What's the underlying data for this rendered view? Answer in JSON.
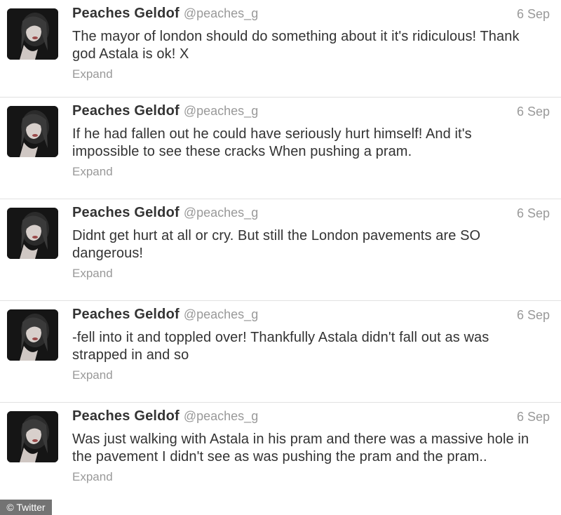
{
  "tweets": [
    {
      "name": "Peaches Geldof",
      "handle": "@peaches_g",
      "date": "6 Sep",
      "text": "The mayor of london should do something about it it's ridiculous! Thank god Astala is ok! X",
      "expand": "Expand"
    },
    {
      "name": "Peaches Geldof",
      "handle": "@peaches_g",
      "date": "6 Sep",
      "text": "If he had fallen out he could have seriously hurt himself! And it's impossible to see these cracks When pushing a pram.",
      "expand": "Expand"
    },
    {
      "name": "Peaches Geldof",
      "handle": "@peaches_g",
      "date": "6 Sep",
      "text": "Didnt get hurt at all or cry. But still the London pavements are SO dangerous!",
      "expand": "Expand"
    },
    {
      "name": "Peaches Geldof",
      "handle": "@peaches_g",
      "date": "6 Sep",
      "text": "-fell into it and toppled over! Thankfully Astala didn't fall out as was strapped in and so",
      "expand": "Expand"
    },
    {
      "name": "Peaches Geldof",
      "handle": "@peaches_g",
      "date": "6 Sep",
      "text": "Was just walking with Astala in his pram and there was a massive hole in the pavement I didn't see as was pushing the pram and the pram..",
      "expand": "Expand"
    }
  ],
  "credit": "© Twitter"
}
